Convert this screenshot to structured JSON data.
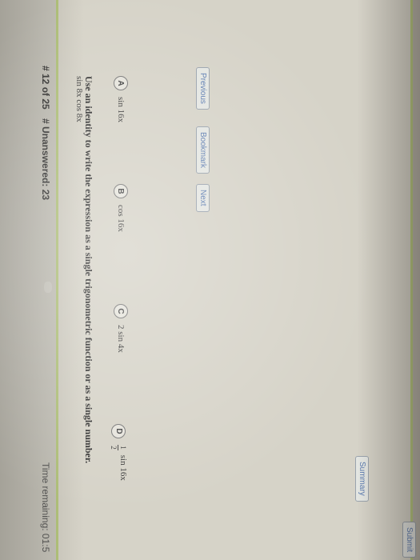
{
  "header": {
    "question_counter": "# 12 of 25",
    "unanswered": "# Unanswered: 23",
    "time_remaining": "Time remaining: 01:5"
  },
  "question": {
    "prompt": "Use an identity to write the expression as a single trigonometric function or as a single number.",
    "expression": "sin 8x cos 8x"
  },
  "choices": [
    {
      "letter": "A",
      "text": "sin 16x"
    },
    {
      "letter": "B",
      "text": "cos 16x"
    },
    {
      "letter": "C",
      "text": "2 sin 4x"
    },
    {
      "letter": "D",
      "fraction_num": "1",
      "fraction_den": "2",
      "text": "sin 16x"
    }
  ],
  "buttons": {
    "previous": "Previous",
    "bookmark": "Bookmark",
    "next": "Next",
    "summary": "Summary",
    "submit": "Submit"
  }
}
